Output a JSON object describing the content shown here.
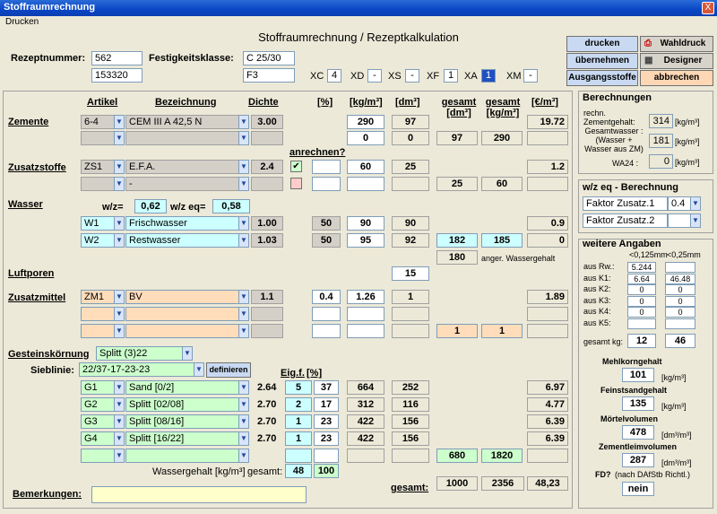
{
  "window": {
    "title": "Stoffraumrechnung",
    "close": "X"
  },
  "menu": {
    "print": "Drucken"
  },
  "app_title": "Stoffraumrechnung / Rezeptkalkulation",
  "header": {
    "rezept_label": "Rezeptnummer:",
    "rezept1": "562",
    "rezept2": "153320",
    "festigkeit_label": "Festigkeitsklasse:",
    "fest1": "C 25/30",
    "fest2": "F3",
    "exp": [
      {
        "k": "XC",
        "v": "4"
      },
      {
        "k": "XD",
        "v": "-"
      },
      {
        "k": "XS",
        "v": "-"
      },
      {
        "k": "XF",
        "v": "1"
      },
      {
        "k": "XA",
        "v": "1"
      },
      {
        "k": "XM",
        "v": "-"
      }
    ]
  },
  "buttons": {
    "drucken": "drucken",
    "wahldruck": "Wahldruck",
    "uebernehmen": "übernehmen",
    "designer": "Designer",
    "ausgangsstoffe": "Ausgangsstoffe",
    "abbrechen": "abbrechen"
  },
  "cols": {
    "artikel": "Artikel",
    "bez": "Bezeichnung",
    "dichte": "Dichte",
    "pct": "[%]",
    "kg": "[kg/m³]",
    "dm": "[dm³]",
    "gesamt_dm": "gesamt\n[dm³]",
    "gesamt_kg": "gesamt\n[kg/m³]",
    "eur": "[€/m³]",
    "gesamt": "gesamt",
    "dm3": "[dm³]",
    "kgm3": "[kg/m³]"
  },
  "zemente": {
    "label": "Zemente",
    "rows": [
      {
        "art": "6-4",
        "bez": "CEM III A 42,5 N",
        "dichte": "3.00",
        "kg": "290",
        "dm": "97",
        "eur": "19.72"
      },
      {
        "art": "",
        "bez": "",
        "dichte": "",
        "kg": "0",
        "dm": "0",
        "eur": ""
      }
    ],
    "gdm": "97",
    "gkg": "290"
  },
  "zusatz": {
    "label": "Zusatzstoffe",
    "anrechnen": "anrechnen?",
    "rows": [
      {
        "art": "ZS1",
        "bez": "E.F.A.",
        "dichte": "2.4",
        "chk": "✔",
        "kg": "60",
        "dm": "25",
        "eur": "1.2"
      },
      {
        "art": "",
        "bez": "-",
        "dichte": "",
        "chk": "",
        "kg": "",
        "dm": "",
        "eur": ""
      }
    ],
    "gdm": "25",
    "gkg": "60"
  },
  "wasser": {
    "label": "Wasser",
    "wz_label": "w/z=",
    "wz": "0,62",
    "wzeq_label": "w/z eq=",
    "wzeq": "0,58",
    "rows": [
      {
        "art": "W1",
        "bez": "Frischwasser",
        "dichte": "1.00",
        "pct": "50",
        "kg": "90",
        "dm": "90",
        "eur": "0.9"
      },
      {
        "art": "W2",
        "bez": "Restwasser",
        "dichte": "1.03",
        "pct": "50",
        "kg": "95",
        "dm": "92",
        "eur": "0"
      }
    ],
    "gdm": "182",
    "gkg": "185",
    "anger": "180",
    "anger_label": "anger. Wassergehalt"
  },
  "luft": {
    "label": "Luftporen",
    "dm": "15"
  },
  "zusatzmittel": {
    "label": "Zusatzmittel",
    "rows": [
      {
        "art": "ZM1",
        "bez": "BV",
        "dichte": "1.1",
        "pct": "0.4",
        "kg": "1.26",
        "dm": "1",
        "eur": "1.89"
      },
      {
        "art": "",
        "bez": "",
        "dichte": "",
        "pct": "",
        "kg": "",
        "dm": "",
        "eur": ""
      },
      {
        "art": "",
        "bez": "",
        "dichte": "",
        "pct": "",
        "kg": "",
        "dm": "",
        "eur": ""
      }
    ],
    "gdm": "1",
    "gkg": "1"
  },
  "gestein": {
    "label": "Gesteinskörnung",
    "sel": "Splitt (3)22",
    "sieb_label": "Sieblinie:",
    "sieb": "22/37-17-23-23",
    "def": "definieren",
    "eigf": "Eig.f.",
    "pctl": "[%]",
    "rows": [
      {
        "art": "G1",
        "bez": "Sand [0/2]",
        "dichte": "2.64",
        "e": "5",
        "p": "37",
        "kg": "664",
        "dm": "252",
        "eur": "6.97"
      },
      {
        "art": "G2",
        "bez": "Splitt [02/08]",
        "dichte": "2.70",
        "e": "2",
        "p": "17",
        "kg": "312",
        "dm": "116",
        "eur": "4.77"
      },
      {
        "art": "G3",
        "bez": "Splitt [08/16]",
        "dichte": "2.70",
        "e": "1",
        "p": "23",
        "kg": "422",
        "dm": "156",
        "eur": "6.39"
      },
      {
        "art": "G4",
        "bez": "Splitt [16/22]",
        "dichte": "2.70",
        "e": "1",
        "p": "23",
        "kg": "422",
        "dm": "156",
        "eur": "6.39"
      }
    ],
    "gdm": "680",
    "gkg": "1820",
    "wg_label": "Wassergehalt [kg/m³]",
    "wg_gesamt": "gesamt:",
    "wg": "48",
    "sum": "100"
  },
  "totals": {
    "bem_label": "Bemerkungen:",
    "label": "gesamt:",
    "dm": "1000",
    "kg": "2356",
    "eur": "48,23"
  },
  "berechnungen": {
    "title": "Berechnungen",
    "zem_label": "rechn. Zementgehalt:",
    "zem": "314",
    "unit1": "[kg/m³]",
    "gw_label": "Gesamtwasser : (Wasser + Wasser aus ZM)",
    "gw": "181",
    "unit2": "[kg/m³]",
    "wa_label": "WA24 :",
    "wa": "0",
    "unit3": "[kg/m³]"
  },
  "wzeq": {
    "title": "w/z eq - Berechnung",
    "f1": "Faktor Zusatz.1",
    "f1v": "0.4",
    "f2": "Faktor Zusatz.2",
    "f2v": ""
  },
  "weitere": {
    "title": "weitere Angaben",
    "h1": "<0,125mm",
    "h2": "<0,25mm",
    "rows": [
      {
        "l": "aus Rw.:",
        "a": "5.244",
        "b": ""
      },
      {
        "l": "aus K1:",
        "a": "6.64",
        "b": "46.48"
      },
      {
        "l": "aus K2:",
        "a": "0",
        "b": "0"
      },
      {
        "l": "aus K3:",
        "a": "0",
        "b": "0"
      },
      {
        "l": "aus K4:",
        "a": "0",
        "b": "0"
      },
      {
        "l": "aus K5:",
        "a": "",
        "b": ""
      }
    ],
    "gesamt_label": "gesamt kg:",
    "ga": "12",
    "gb": "46",
    "mehl_label": "Mehlkorngehalt",
    "mehl": "101",
    "u1": "[kg/m³]",
    "fein_label": "Feinstsandgehalt",
    "fein": "135",
    "u2": "[kg/m³]",
    "moertel_label": "Mörtelvolumen",
    "moertel": "478",
    "u3": "[dm³/m³]",
    "zl_label": "Zementleimvolumen",
    "zl": "287",
    "u4": "[dm³/m³]",
    "fd_label": "FD?",
    "fd_note": "(nach DAfStb Richtl.)",
    "fd": "nein"
  }
}
